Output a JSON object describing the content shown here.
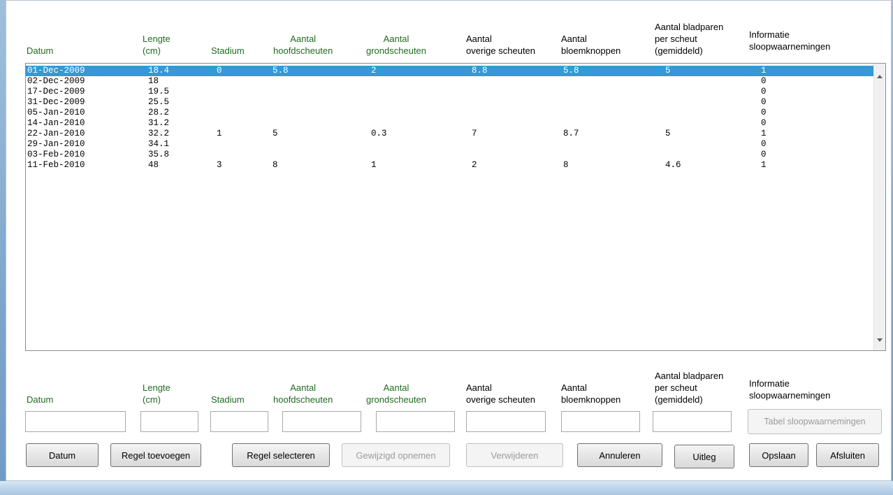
{
  "columns": {
    "datum": [
      "Datum"
    ],
    "lengte": [
      "Lengte",
      "(cm)"
    ],
    "stadium": [
      "Stadium"
    ],
    "hoofd": [
      "Aantal",
      "hoofdscheuten"
    ],
    "grond": [
      "Aantal",
      "grondscheuten"
    ],
    "overige": [
      "Aantal",
      "overige scheuten"
    ],
    "bloem": [
      "Aantal",
      "bloemknoppen"
    ],
    "blad": [
      "Aantal bladparen",
      "per scheut",
      "(gemiddeld)"
    ],
    "info": [
      "Informatie",
      "sloopwaarnemingen"
    ]
  },
  "rows": [
    {
      "datum": "01-Dec-2009",
      "lengte": "18.4",
      "stadium": "0",
      "hoofd": "5.8",
      "grond": "2",
      "overige": "8.8",
      "bloem": "5.8",
      "blad": "5",
      "info": "1",
      "selected": true
    },
    {
      "datum": "02-Dec-2009",
      "lengte": "18",
      "stadium": "",
      "hoofd": "",
      "grond": "",
      "overige": "",
      "bloem": "",
      "blad": "",
      "info": "0"
    },
    {
      "datum": "17-Dec-2009",
      "lengte": "19.5",
      "stadium": "",
      "hoofd": "",
      "grond": "",
      "overige": "",
      "bloem": "",
      "blad": "",
      "info": "0"
    },
    {
      "datum": "31-Dec-2009",
      "lengte": "25.5",
      "stadium": "",
      "hoofd": "",
      "grond": "",
      "overige": "",
      "bloem": "",
      "blad": "",
      "info": "0"
    },
    {
      "datum": "05-Jan-2010",
      "lengte": "28.2",
      "stadium": "",
      "hoofd": "",
      "grond": "",
      "overige": "",
      "bloem": "",
      "blad": "",
      "info": "0"
    },
    {
      "datum": "14-Jan-2010",
      "lengte": "31.2",
      "stadium": "",
      "hoofd": "",
      "grond": "",
      "overige": "",
      "bloem": "",
      "blad": "",
      "info": "0"
    },
    {
      "datum": "22-Jan-2010",
      "lengte": "32.2",
      "stadium": "1",
      "hoofd": "5",
      "grond": "0.3",
      "overige": "7",
      "bloem": "8.7",
      "blad": "5",
      "info": "1"
    },
    {
      "datum": "29-Jan-2010",
      "lengte": "34.1",
      "stadium": "",
      "hoofd": "",
      "grond": "",
      "overige": "",
      "bloem": "",
      "blad": "",
      "info": "0"
    },
    {
      "datum": "03-Feb-2010",
      "lengte": "35.8",
      "stadium": "",
      "hoofd": "",
      "grond": "",
      "overige": "",
      "bloem": "",
      "blad": "",
      "info": "0"
    },
    {
      "datum": "11-Feb-2010",
      "lengte": "48",
      "stadium": "3",
      "hoofd": "8",
      "grond": "1",
      "overige": "2",
      "bloem": "8",
      "blad": "4.6",
      "info": "1"
    }
  ],
  "inputs": {
    "datum": "",
    "lengte": "",
    "stadium": "",
    "hoofd": "",
    "grond": "",
    "overige": "",
    "bloem": "",
    "blad": ""
  },
  "buttons": {
    "tabel": "Tabel sloopwaarnemingen",
    "datum": "Datum",
    "regel_toevoegen": "Regel toevoegen",
    "regel_selecteren": "Regel selecteren",
    "gewijzigd_opnemen": "Gewijzigd opnemen",
    "verwijderen": "Verwijderen",
    "annuleren": "Annuleren",
    "uitleg": "Uitleg",
    "opslaan": "Opslaan",
    "afsluiten": "Afsluiten"
  },
  "colors": {
    "green_header": "#1f6b1f",
    "selection": "#3399d7"
  }
}
